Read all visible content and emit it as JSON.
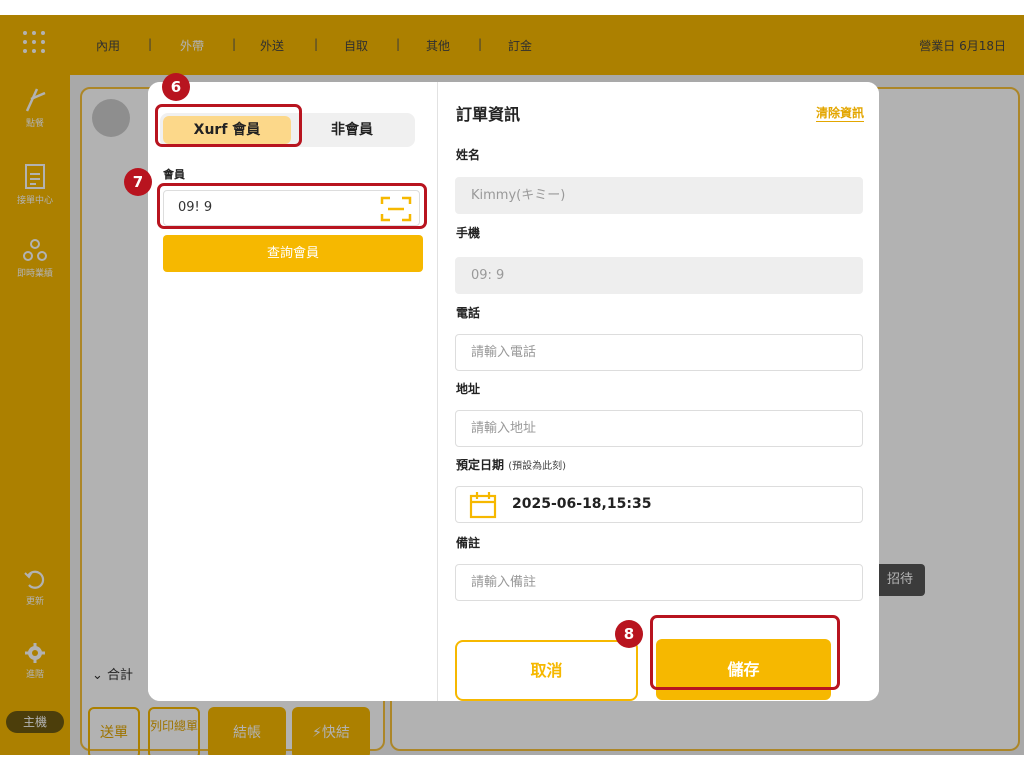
{
  "sidebar": {
    "items": [
      {
        "label": "點餐"
      },
      {
        "label": "接單中心"
      },
      {
        "label": "即時業績"
      },
      {
        "label": "更新"
      },
      {
        "label": "進階"
      }
    ],
    "host_label": "主機"
  },
  "topbar": {
    "tabs": [
      "內用",
      "外帶",
      "外送",
      "自取",
      "其他",
      "訂金"
    ],
    "separator": "|",
    "active_tab": "外帶",
    "business_date": "營業日  6月18日"
  },
  "background": {
    "receive_btn": "招待",
    "total_label": "合計",
    "buttons": [
      "送單",
      "列印總單",
      "結帳",
      "快結"
    ]
  },
  "modal": {
    "segment": {
      "member": "Xurf 會員",
      "non_member": "非會員"
    },
    "member_label": "會員",
    "member_value": "09!          9",
    "query_button": "查詢會員",
    "order_title": "訂單資訊",
    "clear_link": "清除資訊",
    "name_label": "姓名",
    "name_value": "Kimmy(キミー)",
    "mobile_label": "手機",
    "mobile_value": "09:           9",
    "phone_label": "電話",
    "phone_placeholder": "請輸入電話",
    "address_label": "地址",
    "address_placeholder": "請輸入地址",
    "date_label": "預定日期",
    "date_hint": "(預設為此刻)",
    "date_value": "2025-06-18,15:35",
    "note_label": "備註",
    "note_placeholder": "請輸入備註",
    "cancel_button": "取消",
    "save_button": "儲存"
  },
  "annotations": [
    "6",
    "7",
    "8"
  ],
  "colors": {
    "accent": "#f6b800",
    "highlight": "#b8141f"
  }
}
